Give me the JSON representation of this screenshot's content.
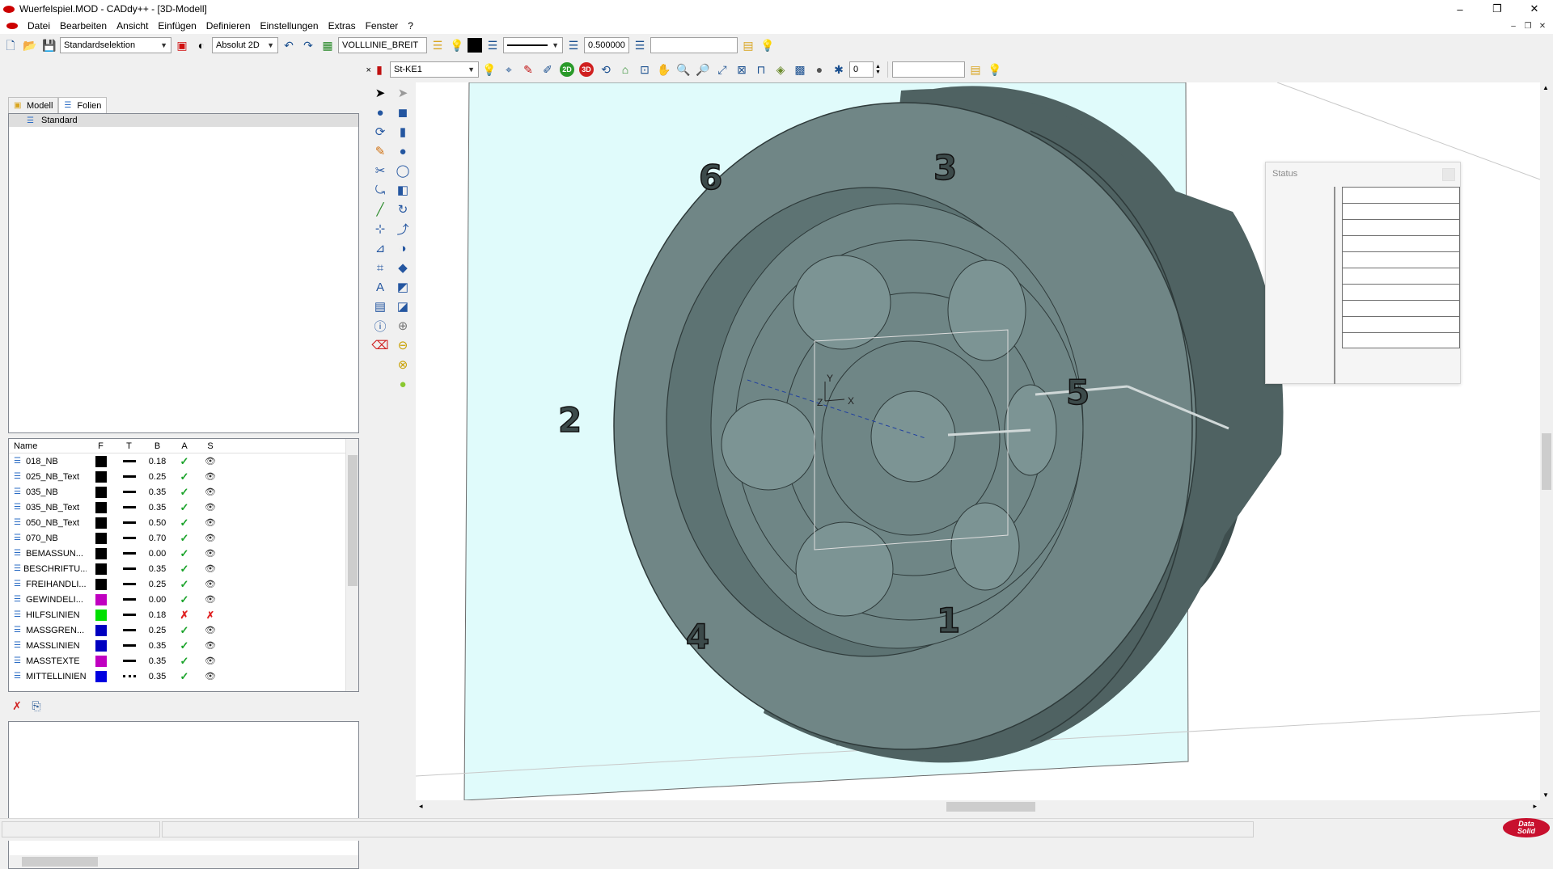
{
  "window": {
    "title": "Wuerfelspiel.MOD  -  CADdy++ - [3D-Modell]",
    "controls": {
      "minimize": "–",
      "restore": "❐",
      "close": "✕"
    }
  },
  "menu": {
    "items": [
      "Datei",
      "Bearbeiten",
      "Ansicht",
      "Einfügen",
      "Definieren",
      "Einstellungen",
      "Extras",
      "Fenster",
      "?"
    ],
    "mdi": {
      "minimize": "–",
      "restore": "❐",
      "close": "✕"
    }
  },
  "toolbar1": {
    "selection_mode": "Standardselektion",
    "coord_mode": "Absolut 2D",
    "linetype": "VOLLLINIE_BREIT",
    "linewidth": "0.500000",
    "extra_value": ""
  },
  "toolbar2": {
    "layer_select": "St-KE1",
    "btn_2d": "2D",
    "btn_3d": "3D",
    "spin_value": "0",
    "extra_value": ""
  },
  "left_panel": {
    "tabs": {
      "model": "Modell",
      "layers": "Folien"
    },
    "folder_item": "Standard",
    "columns": {
      "name": "Name",
      "f": "F",
      "t": "T",
      "b": "B",
      "a": "A",
      "s": "S"
    },
    "layers": [
      {
        "name": "018_NB",
        "color": "#000000",
        "type": "solid",
        "b": "0.18",
        "a": "✓",
        "s": "👁"
      },
      {
        "name": "025_NB_Text",
        "color": "#000000",
        "type": "solid",
        "b": "0.25",
        "a": "✓",
        "s": "👁"
      },
      {
        "name": "035_NB",
        "color": "#000000",
        "type": "solid",
        "b": "0.35",
        "a": "✓",
        "s": "👁"
      },
      {
        "name": "035_NB_Text",
        "color": "#000000",
        "type": "solid",
        "b": "0.35",
        "a": "✓",
        "s": "👁"
      },
      {
        "name": "050_NB_Text",
        "color": "#000000",
        "type": "solid",
        "b": "0.50",
        "a": "✓",
        "s": "👁"
      },
      {
        "name": "070_NB",
        "color": "#000000",
        "type": "solid",
        "b": "0.70",
        "a": "✓",
        "s": "👁"
      },
      {
        "name": "BEMASSUN...",
        "color": "#000000",
        "type": "solid",
        "b": "0.00",
        "a": "✓",
        "s": "👁"
      },
      {
        "name": "BESCHRIFTU...",
        "color": "#000000",
        "type": "solid",
        "b": "0.35",
        "a": "✓",
        "s": "👁"
      },
      {
        "name": "FREIHANDLI...",
        "color": "#000000",
        "type": "solid",
        "b": "0.25",
        "a": "✓",
        "s": "👁"
      },
      {
        "name": "GEWINDELI...",
        "color": "#c000c0",
        "type": "solid",
        "b": "0.00",
        "a": "✓",
        "s": "👁"
      },
      {
        "name": "HILFSLINIEN",
        "color": "#00e000",
        "type": "solid",
        "b": "0.18",
        "a": "✗",
        "s": "✗"
      },
      {
        "name": "MASSGREN...",
        "color": "#0000c0",
        "type": "solid",
        "b": "0.25",
        "a": "✓",
        "s": "👁"
      },
      {
        "name": "MASSLINIEN",
        "color": "#0000c0",
        "type": "solid",
        "b": "0.35",
        "a": "✓",
        "s": "👁"
      },
      {
        "name": "MASSTEXTE",
        "color": "#c000c0",
        "type": "solid",
        "b": "0.35",
        "a": "✓",
        "s": "👁"
      },
      {
        "name": "MITTELLINIEN",
        "color": "#0000e0",
        "type": "dashed",
        "b": "0.35",
        "a": "✓",
        "s": "👁"
      }
    ]
  },
  "viewport": {
    "numbers": [
      "6",
      "3",
      "2",
      "5",
      "4",
      "1"
    ],
    "axis_labels": {
      "x": "X",
      "y": "Y",
      "z": "Z"
    }
  },
  "status_panel": {
    "title": "Status",
    "rows": 10
  },
  "brand": {
    "logo_line1": "Data",
    "logo_line2": "Solid"
  },
  "colors": {
    "model_face": "#6e8484",
    "model_dark": "#4f6262",
    "bbox_fill": "#e0fbfb",
    "accent": "#c8102e"
  }
}
